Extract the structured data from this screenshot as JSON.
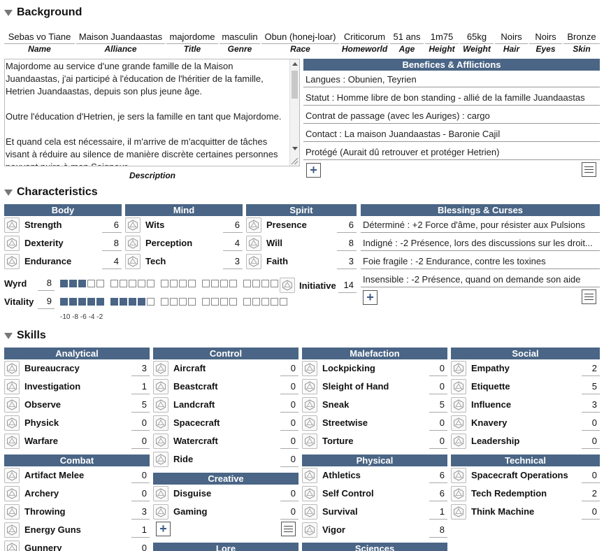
{
  "background": {
    "title": "Background",
    "fields": [
      {
        "value": "Sebas vo Tiane",
        "label": "Name"
      },
      {
        "value": "Maison Juandaastas",
        "label": "Alliance"
      },
      {
        "value": "majordome",
        "label": "Title"
      },
      {
        "value": "masculin",
        "label": "Genre"
      },
      {
        "value": "Obun (honej-loar)",
        "label": "Race"
      },
      {
        "value": "Criticorum",
        "label": "Homeworld"
      },
      {
        "value": "51 ans",
        "label": "Age"
      },
      {
        "value": "1m75",
        "label": "Height"
      },
      {
        "value": "65kg",
        "label": "Weight"
      },
      {
        "value": "Noirs",
        "label": "Hair"
      },
      {
        "value": "Noirs",
        "label": "Eyes"
      },
      {
        "value": "Bronze",
        "label": "Skin"
      }
    ],
    "description": {
      "paragraphs": [
        "Majordome au service d'une grande famille de la Maison Juandaastas, j'ai participé à l'éducation de l'héritier de la famille, Hetrien Juandaastas, depuis son plus jeune âge.",
        "Outre l'éducation d'Hetrien, je sers la famille en tant que Majordome.",
        "Et quand cela est nécessaire, il m'arrive de m'acquitter de tâches visant à réduire au silence de manière discrète certaines personnes pouvant nuire à mon Seigneur."
      ],
      "label": "Description"
    },
    "benefices": {
      "title": "Benefices & Afflictions",
      "items": [
        "Langues : Obunien, Teyrien",
        "Statut : Homme libre de bon standing - allié de la famille Juandaastas",
        "Contrat de passage (avec les Auriges) : cargo",
        "Contact : La maison Juandaastas - Baronie Cajil",
        "Protégé (Aurait dû retrouver et protéger Hetrien)"
      ],
      "add": "+"
    }
  },
  "characteristics": {
    "title": "Characteristics",
    "groups": [
      {
        "title": "Body",
        "stats": [
          {
            "name": "Strength",
            "value": "6"
          },
          {
            "name": "Dexterity",
            "value": "8"
          },
          {
            "name": "Endurance",
            "value": "4"
          }
        ]
      },
      {
        "title": "Mind",
        "stats": [
          {
            "name": "Wits",
            "value": "6"
          },
          {
            "name": "Perception",
            "value": "4"
          },
          {
            "name": "Tech",
            "value": "3"
          }
        ]
      },
      {
        "title": "Spirit",
        "stats": [
          {
            "name": "Presence",
            "value": "6"
          },
          {
            "name": "Will",
            "value": "8"
          },
          {
            "name": "Faith",
            "value": "3"
          }
        ]
      }
    ],
    "wyrd": {
      "label": "Wyrd",
      "value": "8",
      "filled": 3
    },
    "vitality": {
      "label": "Vitality",
      "value": "9",
      "filled": 9
    },
    "penalty_scale": "-10 -8 -6 -4 -2",
    "initiative": {
      "label": "Initiative",
      "value": "14"
    },
    "blessings": {
      "title": "Blessings & Curses",
      "items": [
        "Déterminé : +2 Force d'âme, pour résister aux Pulsions",
        "Indigné : -2 Présence, lors des discussions sur les droit...",
        "Foie fragile : -2 Endurance, contre les toxines",
        "Insensible : -2 Présence, quand on demande son aide"
      ],
      "add": "+"
    }
  },
  "skills": {
    "title": "Skills",
    "groups": [
      {
        "title": "Analytical",
        "skills": [
          {
            "name": "Bureaucracy",
            "value": "3"
          },
          {
            "name": "Investigation",
            "value": "1"
          },
          {
            "name": "Observe",
            "value": "5"
          },
          {
            "name": "Physick",
            "value": "0"
          },
          {
            "name": "Warfare",
            "value": "0"
          }
        ]
      },
      {
        "title": "Control",
        "skills": [
          {
            "name": "Aircraft",
            "value": "0"
          },
          {
            "name": "Beastcraft",
            "value": "0"
          },
          {
            "name": "Landcraft",
            "value": "0"
          },
          {
            "name": "Spacecraft",
            "value": "0"
          },
          {
            "name": "Watercraft",
            "value": "0"
          },
          {
            "name": "Ride",
            "value": "0"
          }
        ]
      },
      {
        "title": "Malefaction",
        "skills": [
          {
            "name": "Lockpicking",
            "value": "0"
          },
          {
            "name": "Sleight of Hand",
            "value": "0"
          },
          {
            "name": "Sneak",
            "value": "5"
          },
          {
            "name": "Streetwise",
            "value": "0"
          },
          {
            "name": "Torture",
            "value": "0"
          }
        ]
      },
      {
        "title": "Social",
        "skills": [
          {
            "name": "Empathy",
            "value": "2"
          },
          {
            "name": "Etiquette",
            "value": "5"
          },
          {
            "name": "Influence",
            "value": "3"
          },
          {
            "name": "Knavery",
            "value": "0"
          },
          {
            "name": "Leadership",
            "value": "0"
          }
        ]
      },
      {
        "title": "Combat",
        "skills": [
          {
            "name": "Artifact Melee",
            "value": "0"
          },
          {
            "name": "Archery",
            "value": "0"
          },
          {
            "name": "Throwing",
            "value": "3"
          },
          {
            "name": "Energy Guns",
            "value": "1"
          },
          {
            "name": "Gunnery",
            "value": "0"
          }
        ]
      },
      {
        "title": "Creative",
        "skills": [
          {
            "name": "Disguise",
            "value": "0"
          },
          {
            "name": "Gaming",
            "value": "0"
          }
        ],
        "add": "+"
      },
      {
        "title": "Physical",
        "skills": [
          {
            "name": "Athletics",
            "value": "6"
          },
          {
            "name": "Self Control",
            "value": "6"
          },
          {
            "name": "Survival",
            "value": "1"
          },
          {
            "name": "Vigor",
            "value": "8"
          }
        ]
      },
      {
        "title": "Technical",
        "skills": [
          {
            "name": "Spacecraft Operations",
            "value": "0"
          },
          {
            "name": "Tech Redemption",
            "value": "2"
          },
          {
            "name": "Think Machine",
            "value": "0"
          }
        ]
      },
      {
        "title": "Lore",
        "skills": []
      },
      {
        "title": "Sciences",
        "skills": []
      }
    ]
  },
  "colors": {
    "header": "#4a6585",
    "filled_box": "#4a6585",
    "border": "#999"
  },
  "icons": {
    "die": "d20-die-icon",
    "collapse": "collapse-triangle-icon",
    "add": "plus-icon",
    "menu": "hamburger-menu-icon"
  }
}
